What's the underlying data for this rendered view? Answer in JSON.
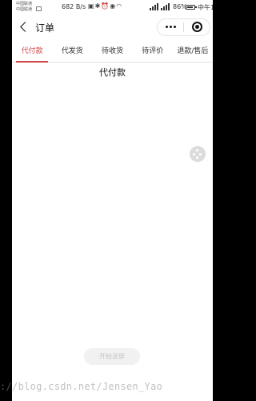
{
  "status_bar": {
    "carrier_1": "中国联通",
    "carrier_2": "中国联通",
    "net_speed": "682 B/s",
    "battery_percent": "86%",
    "battery_level": 0.86,
    "time": "中午11:12"
  },
  "nav": {
    "title": "订单"
  },
  "tabs": [
    {
      "label": "代付款",
      "active": true
    },
    {
      "label": "代发货",
      "active": false
    },
    {
      "label": "待收货",
      "active": false
    },
    {
      "label": "待评价",
      "active": false
    },
    {
      "label": "退款/售后",
      "active": false
    }
  ],
  "content": {
    "title": "代付款"
  },
  "record_button": {
    "label": "开始录屏"
  },
  "watermark": "://blog.csdn.net/Jensen_Yao",
  "colors": {
    "accent": "#d04a4a",
    "background": "#ffffff",
    "divider": "#e3e3e3"
  },
  "icons": {
    "back": "back-chevron-icon",
    "more": "more-dots-icon",
    "close": "close-circle-icon",
    "float": "floating-assistant-icon"
  }
}
